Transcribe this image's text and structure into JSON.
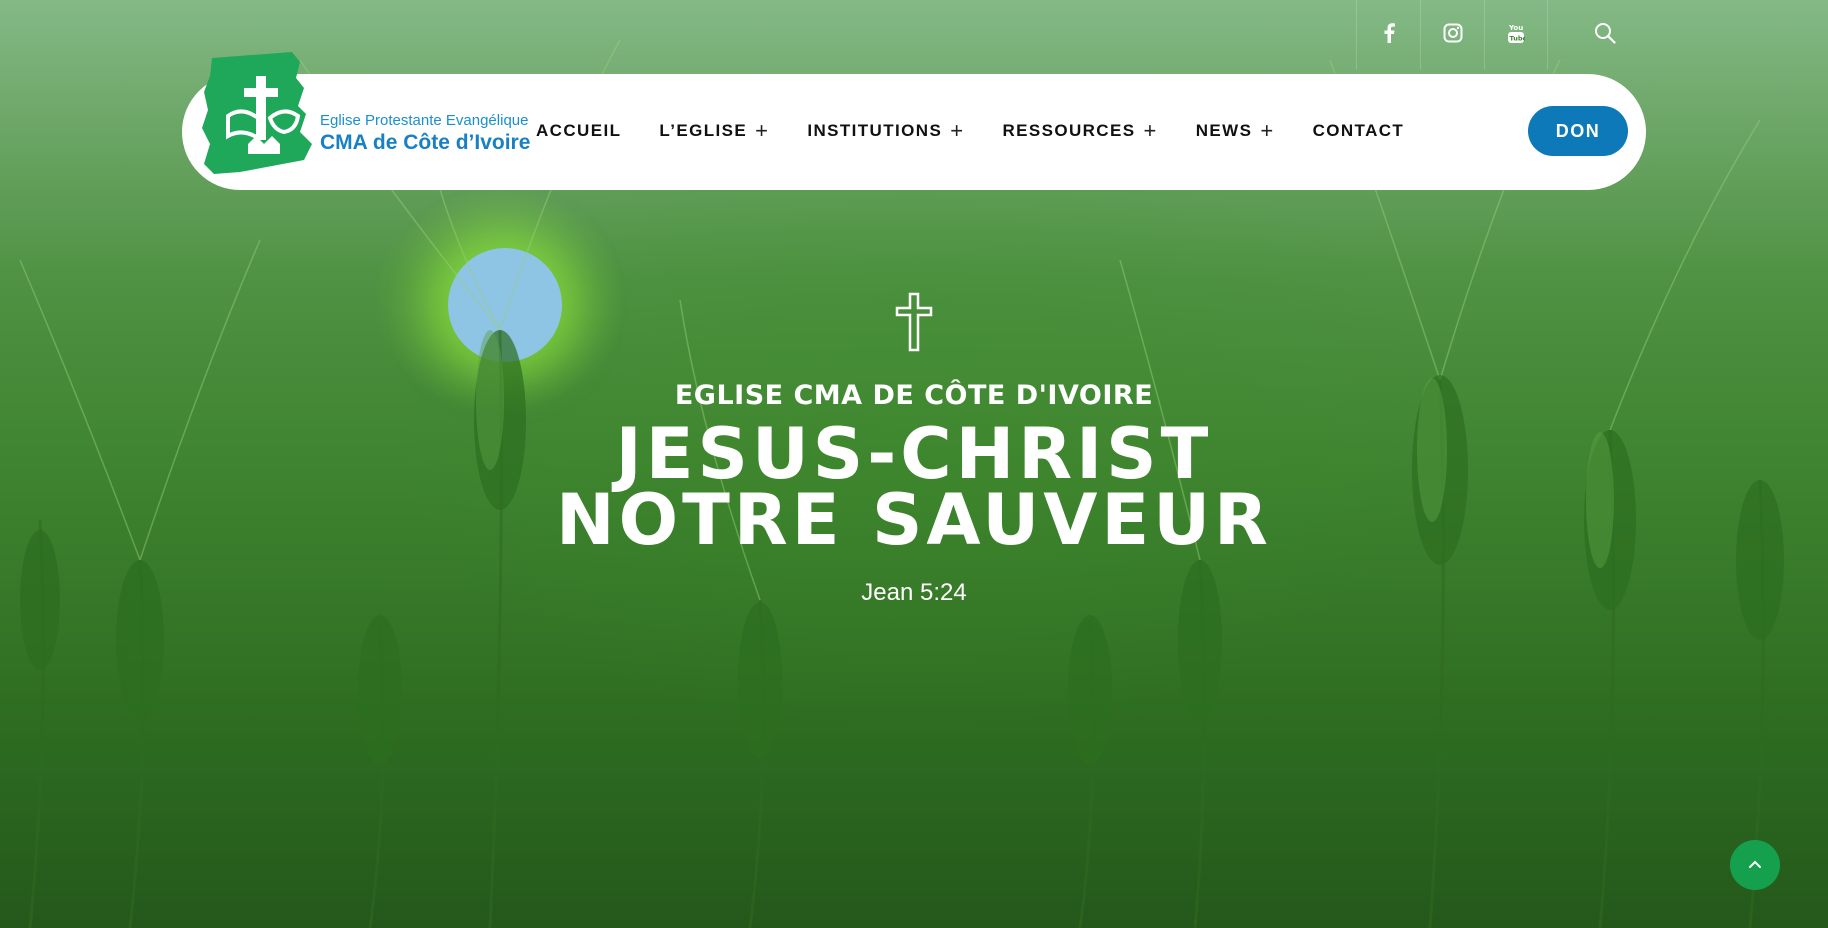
{
  "colors": {
    "accent_blue": "#0e79b8",
    "logo_green": "#1fa85a",
    "logo_text_blue": "#1a8fd0",
    "scroll_button_green": "#15a04e",
    "nav_background": "#ffffff"
  },
  "social": [
    {
      "icon": "facebook-icon"
    },
    {
      "icon": "instagram-icon"
    },
    {
      "icon": "youtube-icon"
    }
  ],
  "search": {
    "icon": "search-icon"
  },
  "logo": {
    "line1": "Eglise Protestante Evangélique",
    "line2": "CMA de Côte d’Ivoire"
  },
  "nav": {
    "items": [
      {
        "label": "ACCUEIL",
        "has_submenu": false
      },
      {
        "label": "L’EGLISE",
        "has_submenu": true
      },
      {
        "label": "INSTITUTIONS",
        "has_submenu": true
      },
      {
        "label": "RESSOURCES",
        "has_submenu": true
      },
      {
        "label": "NEWS",
        "has_submenu": true
      },
      {
        "label": "CONTACT",
        "has_submenu": false
      }
    ],
    "submenu_symbol": "+",
    "don_label": "DON"
  },
  "hero": {
    "icon": "cross-icon",
    "subtitle": "EGLISE CMA DE CÔTE D'IVOIRE",
    "title_line1": "JESUS-CHRIST",
    "title_line2": "NOTRE SAUVEUR",
    "verse": "Jean 5:24"
  },
  "scroll_top": {
    "icon": "chevron-up-icon"
  }
}
